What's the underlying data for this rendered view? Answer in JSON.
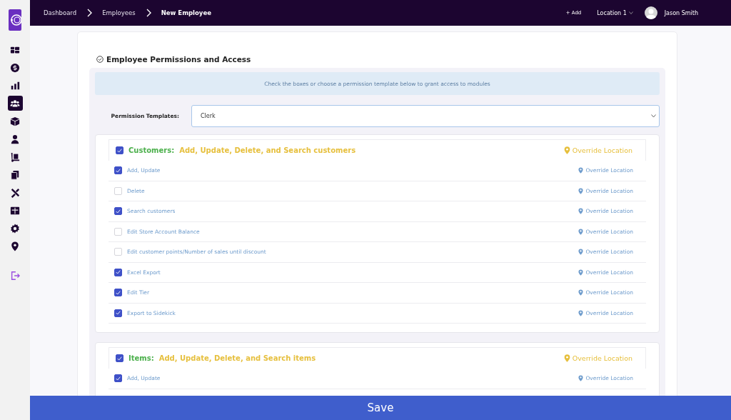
{
  "sidebar": {
    "items": [
      {
        "selected": false
      },
      {
        "selected": false
      },
      {
        "selected": false
      },
      {
        "selected": true
      },
      {
        "selected": false
      },
      {
        "selected": false
      },
      {
        "selected": false
      },
      {
        "selected": false
      },
      {
        "selected": false
      },
      {
        "selected": false
      },
      {
        "selected": false
      },
      {
        "selected": false
      }
    ]
  },
  "breadcrumbs": [
    {
      "label": "Dashboard",
      "current": false
    },
    {
      "label": "Employees",
      "current": false
    },
    {
      "label": "New Employee",
      "current": true
    }
  ],
  "topbar": {
    "add": "+ Add",
    "location": "Location 1",
    "user": "Jason Smith"
  },
  "section_title": "Employee Permissions and Access",
  "info": "Check the boxes or choose a permission template below to grant access to modules",
  "template": {
    "label": "Permission Templates:",
    "value": "Clerk"
  },
  "groups": [
    {
      "name": "Customers:",
      "description": "Add, Update, Delete, and Search customers",
      "checked": true,
      "override": "Override Location",
      "rows": [
        {
          "label": "Add, Update",
          "checked": true,
          "override": "Override Location"
        },
        {
          "label": "Delete",
          "checked": false,
          "override": "Override Location"
        },
        {
          "label": "Search customers",
          "checked": true,
          "override": "Override Location"
        },
        {
          "label": "Edit Store Account Balance",
          "checked": false,
          "override": "Override Location"
        },
        {
          "label": "Edit customer points/Number of sales until discount",
          "checked": false,
          "override": "Override Location"
        },
        {
          "label": "Excel Export",
          "checked": true,
          "override": "Override Location"
        },
        {
          "label": "Edit Tier",
          "checked": true,
          "override": "Override Location"
        },
        {
          "label": "Export to Sidekick",
          "checked": true,
          "override": "Override Location"
        }
      ]
    },
    {
      "name": "Items:",
      "description": "Add, Update, Delete, and Search items",
      "checked": true,
      "override": "Override Location",
      "rows": [
        {
          "label": "Add, Update",
          "checked": true,
          "override": "Override Location"
        }
      ]
    }
  ],
  "save": "Save"
}
